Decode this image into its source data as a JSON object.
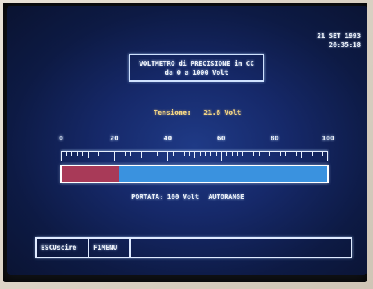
{
  "clock": {
    "date": "21 SET 1993",
    "time": "20:35:18"
  },
  "title": {
    "line1": "VOLTMETRO di PRECISIONE in CC",
    "line2": "da 0 a 1000 Volt"
  },
  "reading": {
    "label": "Tensione:",
    "value": "21.6 Volt",
    "fraction_of_scale": 0.216
  },
  "scale": {
    "labels": [
      "0",
      "20",
      "40",
      "60",
      "80",
      "100"
    ],
    "max": 100,
    "major_ticks": 5,
    "minor_per_major": 10
  },
  "bar": {
    "fill_color": "#a83a58",
    "rest_color": "#3a92df"
  },
  "range": {
    "label": "PORTATA:",
    "value": "100 Volt",
    "mode": "AUTORANGE"
  },
  "footer": {
    "esc_key": "ESC",
    "esc_action": "Uscire",
    "f1_key": "F1",
    "f1_action": "MENU"
  }
}
